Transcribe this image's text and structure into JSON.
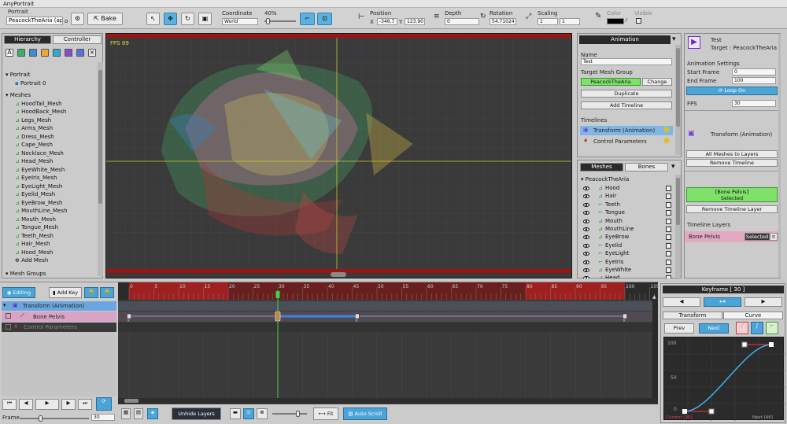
{
  "app": {
    "title": "AnyPortrait"
  },
  "toolbar": {
    "portrait_label": "Portrait",
    "portrait_value": "PeacockTheAria (ap",
    "bake_label": "Bake",
    "coordinate_label": "Coordinate",
    "coordinate_value": "World",
    "zoom_value": "40%",
    "position_label": "Position",
    "pos_x_label": "X",
    "pos_x": "-346.7",
    "pos_y_label": "Y",
    "pos_y": "123.90",
    "depth_label": "Depth",
    "depth": "0",
    "rotation_label": "Rotation",
    "rotation": "54.71024",
    "scaling_label": "Scaling",
    "scale_x": "1",
    "scale_y": "1",
    "color_label": "Color",
    "visible_label": "Visible"
  },
  "hierarchy": {
    "tab_hierarchy": "Hierarchy",
    "tab_controller": "Controller",
    "portrait_section": "Portrait",
    "portrait_item": "Portrait 0",
    "meshes_section": "Meshes",
    "meshes": [
      "HoodTail_Mesh",
      "HoodBack_Mesh",
      "Legs_Mesh",
      "Arms_Mesh",
      "Dress_Mesh",
      "Cape_Mesh",
      "Necklace_Mesh",
      "Head_Mesh",
      "EyeWhite_Mesh",
      "EyeIris_Mesh",
      "EyeLight_Mesh",
      "Eyelid_Mesh",
      "EyeBrow_Mesh",
      "MouthLine_Mesh",
      "Mouth_Mesh",
      "Tongue_Mesh",
      "Teeth_Mesh",
      "Hair_Mesh",
      "Hood_Mesh"
    ],
    "add_mesh": "Add Mesh",
    "mesh_groups": "Mesh Groups"
  },
  "viewport": {
    "fps": "FPS 89"
  },
  "animation_panel": {
    "header": "Animation",
    "name_label": "Name",
    "name_value": "Test",
    "target_label": "Target Mesh Group",
    "target_value": "PeacockTheAria",
    "change_label": "Change",
    "duplicate_label": "Duplicate",
    "add_timeline_label": "Add Timeline",
    "timelines_label": "Timelines",
    "timelines": [
      "Transform (Animation)",
      "Control Parameters"
    ]
  },
  "mesh_panel": {
    "tab_meshes": "Meshes",
    "tab_bones": "Bones",
    "root": "PeacockTheAria",
    "items": [
      "Hood",
      "Hair",
      "Teeth",
      "Tongue",
      "Mouth",
      "MouthLine",
      "EyeBrow",
      "Eyelid",
      "EyeLight",
      "EyeIris",
      "EyeWhite",
      "Head"
    ]
  },
  "right_panel": {
    "anim_name": "Test",
    "anim_target": "Target : PeacockTheAria",
    "settings_label": "Animation Settings",
    "start_frame_label": "Start Frame",
    "start_frame": "0",
    "end_frame_label": "End Frame",
    "end_frame": "100",
    "loop_label": "Loop On",
    "fps_label": "FPS",
    "fps_value": "30",
    "timeline_name": "Transform (Animation)",
    "all_meshes_label": "All Meshes to Layers",
    "remove_timeline_label": "Remove Timeline",
    "bone_selected_line1": "[Bone Pelvis]",
    "bone_selected_line2": "Selected",
    "remove_layer_label": "Remove Timeline Layer",
    "timeline_layers_label": "Timeline Layers",
    "layer_name": "Bone Pelvis",
    "layer_state": "Selected"
  },
  "timeline": {
    "editing_label": "Editing",
    "add_key_label": "Add Key",
    "rows": [
      "Transform (Animation)",
      "Bone Pelvis",
      "Control Parameters"
    ],
    "ticks": [
      "0",
      "5",
      "10",
      "15",
      "20",
      "25",
      "30",
      "35",
      "40",
      "45",
      "50",
      "55",
      "60",
      "65",
      "70",
      "75",
      "80",
      "85",
      "90",
      "95",
      "100",
      "105"
    ],
    "current_frame": 30,
    "keyframes": [
      0,
      30,
      46,
      100
    ],
    "frame_label": "Frame",
    "frame_value": "30",
    "unhide_layers": "Unhide Layers",
    "fit_label": "Fit",
    "auto_scroll": "Auto Scroll"
  },
  "keyframe_panel": {
    "title": "Keyframe [ 30 ]",
    "tab_transform": "Transform",
    "tab_curve": "Curve",
    "prev_label": "Prev",
    "next_label": "Next",
    "y_top": "100",
    "y_mid": "50",
    "y_bottom": "0",
    "current_label": "Current [30]",
    "next_key_label": "Next [46]"
  },
  "colors": {
    "accent": "#4aa4d8",
    "selected_green": "#7fe06a",
    "keyframe_orange": "#e0703c",
    "playhead": "#39d84a"
  }
}
